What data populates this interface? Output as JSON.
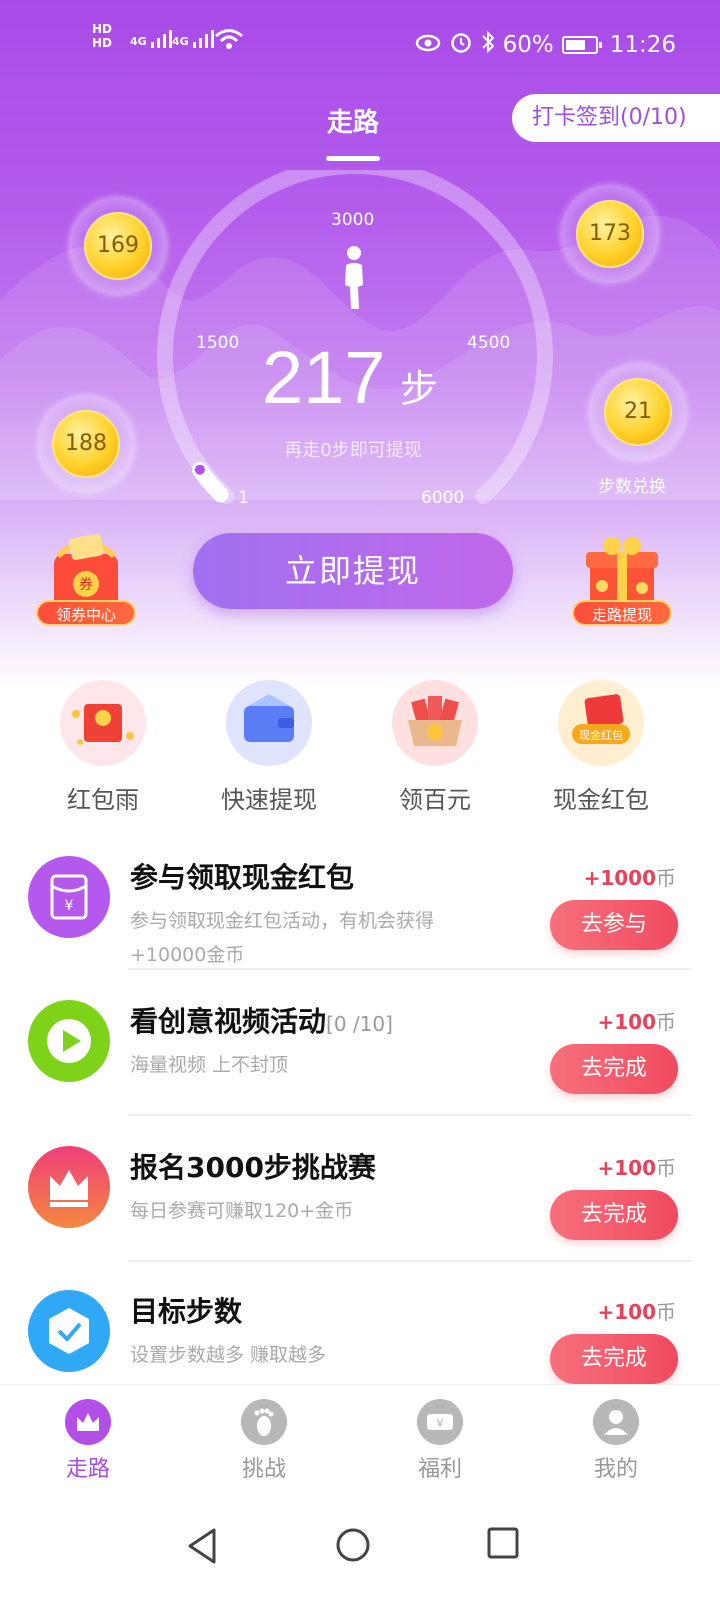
{
  "status_bar": {
    "left": "HD",
    "network": "4G",
    "battery": "60%",
    "time": "11:26"
  },
  "header": {
    "tab": "走路",
    "checkin": "打卡签到(0/10)"
  },
  "gauge": {
    "marks": [
      "3000",
      "1500",
      "4500",
      "1",
      "6000"
    ],
    "steps": "217",
    "unit": "步",
    "tip": "再走0步即可提现",
    "progress_fraction": 0.036
  },
  "coins": {
    "c1": "169",
    "c2": "173",
    "c3": "188",
    "c4": "21",
    "c4_caption": "步数兑换"
  },
  "actions": {
    "withdraw": "立即提现",
    "coupon_center": "领券中心",
    "coupon_mark": "券",
    "walk_withdraw": "走路提现"
  },
  "quick": [
    {
      "label": "红包雨",
      "icon": "red-envelope-rain-icon"
    },
    {
      "label": "快速提现",
      "icon": "wallet-icon"
    },
    {
      "label": "领百元",
      "icon": "cash-hundred-icon"
    },
    {
      "label": "现金红包",
      "icon": "cash-red-packet-icon",
      "badge": "现金红包"
    }
  ],
  "tasks": [
    {
      "title": "参与领取现金红包",
      "progress": "",
      "desc": "参与领取现金红包活动，有机会获得+10000金币",
      "reward": "+1000",
      "unit": "币",
      "button": "去参与",
      "icon_color": "#b458ee"
    },
    {
      "title": "看创意视频活动",
      "progress": "[0 /10]",
      "desc": "海量视频 上不封顶",
      "reward": "+100",
      "unit": "币",
      "button": "去完成",
      "icon_color": "#7ed31a"
    },
    {
      "title": "报名3000步挑战赛",
      "progress": "",
      "desc": "每日参赛可赚取120+金币",
      "reward": "+100",
      "unit": "币",
      "button": "去完成",
      "icon_color": "#f2566a"
    },
    {
      "title": "目标步数",
      "progress": "",
      "desc": "设置步数越多 赚取越多",
      "reward": "+100",
      "unit": "币",
      "button": "去完成",
      "icon_color": "#2fa8f5"
    }
  ],
  "nav": [
    {
      "label": "走路"
    },
    {
      "label": "挑战"
    },
    {
      "label": "福利"
    },
    {
      "label": "我的"
    }
  ]
}
